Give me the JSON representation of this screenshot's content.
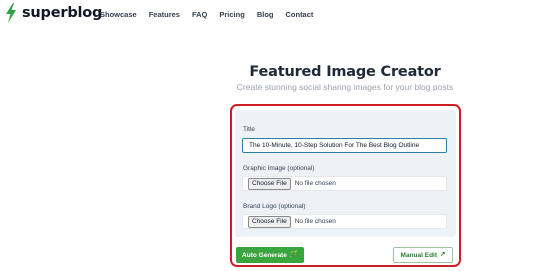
{
  "brand": {
    "name": "superblog",
    "logo_icon": "lightning-bolt-icon",
    "accent_color": "#2ea043"
  },
  "nav": {
    "items": [
      {
        "label": "Showcase"
      },
      {
        "label": "Features"
      },
      {
        "label": "FAQ"
      },
      {
        "label": "Pricing"
      },
      {
        "label": "Blog"
      },
      {
        "label": "Contact"
      }
    ]
  },
  "hero": {
    "title": "Featured Image Creator",
    "subtitle": "Create stunning social sharing images for your blog posts"
  },
  "form": {
    "title_label": "Title",
    "title_value": "The 10-Minute, 10-Step Solution For The Best Blog Outline",
    "graphic_label": "Graphic Image (optional)",
    "graphic_button": "Choose File",
    "graphic_status": "No file chosen",
    "logo_label": "Brand Logo (optional)",
    "logo_button": "Choose File",
    "logo_status": "No file chosen"
  },
  "actions": {
    "auto_generate_label": "Auto Generate",
    "auto_generate_icon": "magic-wand-icon",
    "manual_edit_label": "Manual Edit",
    "manual_edit_icon": "external-link-arrow-icon",
    "primary_color": "#3aa43e",
    "highlight_border_color": "#d01f2a"
  }
}
